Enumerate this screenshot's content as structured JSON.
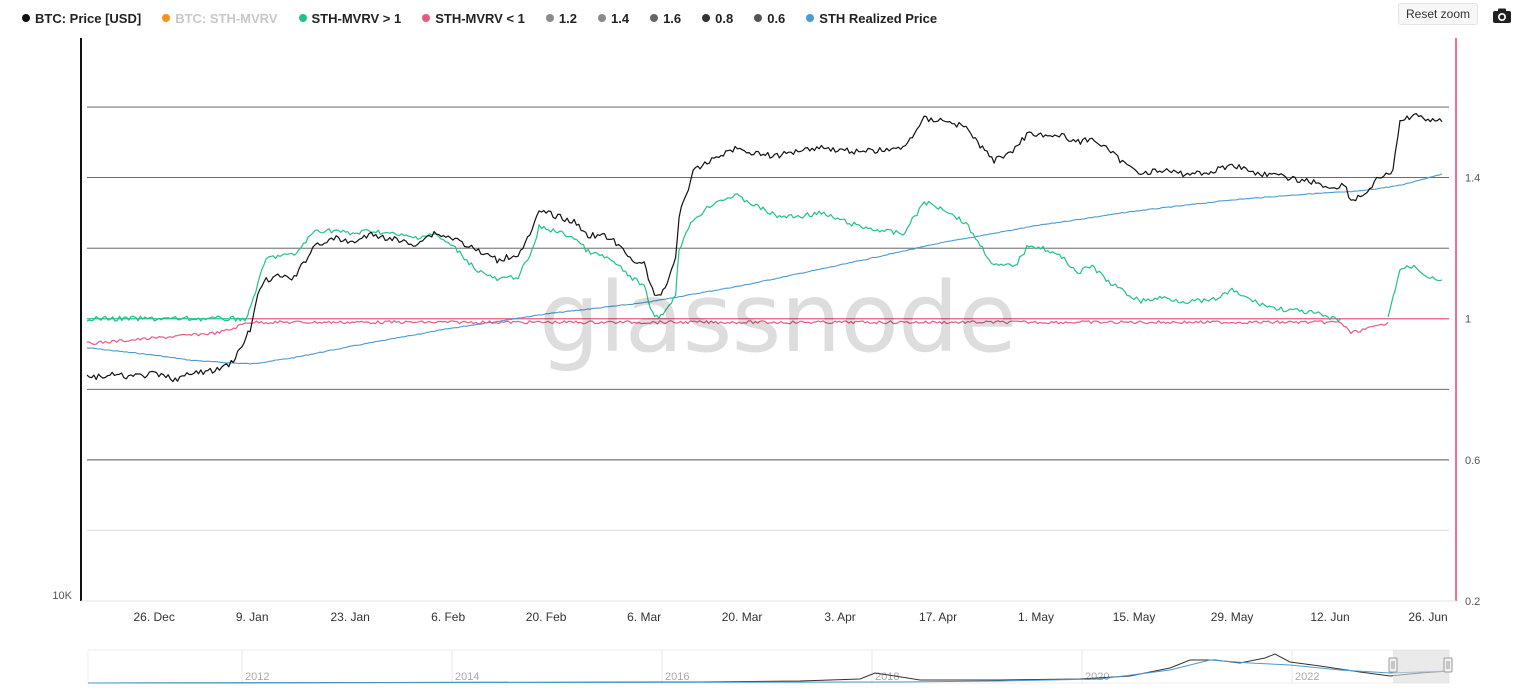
{
  "legend": [
    {
      "label": "BTC: Price [USD]",
      "color": "#111111",
      "active": true
    },
    {
      "label": "BTC: STH-MVRV",
      "color": "#f7931a",
      "active": false
    },
    {
      "label": "STH-MVRV > 1",
      "color": "#1fc28a",
      "active": true
    },
    {
      "label": "STH-MVRV < 1",
      "color": "#e85a7e",
      "active": true
    },
    {
      "label": "1.2",
      "color": "#8a8a8a",
      "active": true
    },
    {
      "label": "1.4",
      "color": "#8a8a8a",
      "active": true
    },
    {
      "label": "1.6",
      "color": "#666666",
      "active": true
    },
    {
      "label": "0.8",
      "color": "#333333",
      "active": true
    },
    {
      "label": "0.6",
      "color": "#555555",
      "active": true
    },
    {
      "label": "STH Realized Price",
      "color": "#4a9bd1",
      "active": true
    }
  ],
  "toolbar": {
    "reset_zoom_label": "Reset zoom",
    "camera_icon": "camera-icon"
  },
  "watermark": "glassnode",
  "colors": {
    "price": "#111111",
    "mvrv_above": "#1fc28a",
    "mvrv_below": "#e85a7e",
    "realized": "#4a9bd1",
    "level_line": "#555555",
    "left_axis": "#111111",
    "right_axis": "#e0457b"
  },
  "chart_data": {
    "type": "line",
    "x_ticks": [
      "26. Dec",
      "9. Jan",
      "23. Jan",
      "6. Feb",
      "20. Feb",
      "6. Mar",
      "20. Mar",
      "3. Apr",
      "17. Apr",
      "1. May",
      "15. May",
      "29. May",
      "12. Jun",
      "26. Jun"
    ],
    "x_tick_days": [
      0,
      14,
      28,
      42,
      56,
      70,
      84,
      98,
      112,
      126,
      140,
      154,
      168,
      182
    ],
    "x_range": [
      -9.6,
      185.0
    ],
    "y_left_ticks": [
      "10K"
    ],
    "y_left_scale": "log",
    "y_right_ticks": [
      "1.4",
      "1",
      "0.6",
      "0.2"
    ],
    "y_right_tick_values": [
      1.4,
      1.0,
      0.6,
      0.2
    ],
    "y_right_range": [
      0.2,
      1.79
    ],
    "levels": [
      1.6,
      1.4,
      1.2,
      1.0,
      0.8,
      0.6,
      0.4
    ],
    "series": [
      {
        "name": "BTC: Price [USD]",
        "axis": "left",
        "points": [
          [
            -9.6,
            16700
          ],
          [
            -6,
            16800
          ],
          [
            -3,
            16750
          ],
          [
            0,
            16850
          ],
          [
            3,
            16650
          ],
          [
            6,
            16900
          ],
          [
            9,
            17000
          ],
          [
            11,
            17300
          ],
          [
            12.5,
            17900
          ],
          [
            14,
            18900
          ],
          [
            14.8,
            20300
          ],
          [
            16,
            20900
          ],
          [
            18,
            21100
          ],
          [
            20,
            21000
          ],
          [
            23,
            22700
          ],
          [
            26,
            23000
          ],
          [
            28,
            22800
          ],
          [
            31,
            23200
          ],
          [
            34,
            23000
          ],
          [
            37,
            22700
          ],
          [
            40,
            23300
          ],
          [
            43,
            23000
          ],
          [
            46,
            22400
          ],
          [
            49,
            21900
          ],
          [
            52,
            22200
          ],
          [
            54,
            23400
          ],
          [
            55,
            24500
          ],
          [
            57,
            24300
          ],
          [
            60,
            23900
          ],
          [
            62,
            23200
          ],
          [
            65,
            23100
          ],
          [
            68,
            22000
          ],
          [
            70,
            21700
          ],
          [
            71.5,
            20100
          ],
          [
            73,
            20500
          ],
          [
            74.5,
            22100
          ],
          [
            75,
            24200
          ],
          [
            77,
            26800
          ],
          [
            80,
            27700
          ],
          [
            83,
            28300
          ],
          [
            86,
            28000
          ],
          [
            89,
            27800
          ],
          [
            92,
            28200
          ],
          [
            95,
            28400
          ],
          [
            98,
            28200
          ],
          [
            101,
            28100
          ],
          [
            104,
            28200
          ],
          [
            107,
            28300
          ],
          [
            110,
            30300
          ],
          [
            113,
            30200
          ],
          [
            116,
            29700
          ],
          [
            118,
            28500
          ],
          [
            120,
            27500
          ],
          [
            123,
            28300
          ],
          [
            125,
            29400
          ],
          [
            127,
            29200
          ],
          [
            130,
            29100
          ],
          [
            132,
            28700
          ],
          [
            134,
            29000
          ],
          [
            136,
            28300
          ],
          [
            139,
            27200
          ],
          [
            141,
            26800
          ],
          [
            144,
            26900
          ],
          [
            147,
            26700
          ],
          [
            151,
            26800
          ],
          [
            154,
            27300
          ],
          [
            157,
            26800
          ],
          [
            160,
            26600
          ],
          [
            164,
            26300
          ],
          [
            166,
            26200
          ],
          [
            168,
            25800
          ],
          [
            170,
            26100
          ],
          [
            171,
            25100
          ],
          [
            173,
            25500
          ],
          [
            175,
            26500
          ],
          [
            177,
            26800
          ],
          [
            178,
            30200
          ],
          [
            180,
            30500
          ],
          [
            182,
            30300
          ],
          [
            184,
            30100
          ]
        ]
      },
      {
        "name": "STH-MVRV > 1",
        "axis": "right",
        "points": [
          [
            -9.6,
            1.0
          ],
          [
            13.3,
            1.0
          ],
          [
            13.5,
            1.02
          ],
          [
            14.5,
            1.08
          ],
          [
            16,
            1.17
          ],
          [
            18,
            1.18
          ],
          [
            20,
            1.18
          ],
          [
            23,
            1.25
          ],
          [
            26,
            1.25
          ],
          [
            28,
            1.24
          ],
          [
            31,
            1.25
          ],
          [
            34,
            1.24
          ],
          [
            37,
            1.23
          ],
          [
            40,
            1.24
          ],
          [
            43,
            1.2
          ],
          [
            46,
            1.14
          ],
          [
            49,
            1.11
          ],
          [
            52,
            1.12
          ],
          [
            54,
            1.19
          ],
          [
            55,
            1.26
          ],
          [
            57,
            1.25
          ],
          [
            60,
            1.23
          ],
          [
            62,
            1.19
          ],
          [
            65,
            1.17
          ],
          [
            68,
            1.12
          ],
          [
            70,
            1.09
          ],
          [
            71.5,
            1.0
          ],
          [
            73,
            1.02
          ],
          [
            74.5,
            1.07
          ],
          [
            75,
            1.2
          ],
          [
            77,
            1.28
          ],
          [
            80,
            1.33
          ],
          [
            83,
            1.35
          ],
          [
            86,
            1.32
          ],
          [
            89,
            1.29
          ],
          [
            92,
            1.29
          ],
          [
            95,
            1.3
          ],
          [
            98,
            1.28
          ],
          [
            101,
            1.26
          ],
          [
            104,
            1.25
          ],
          [
            107,
            1.24
          ],
          [
            110,
            1.33
          ],
          [
            113,
            1.31
          ],
          [
            116,
            1.27
          ],
          [
            118,
            1.21
          ],
          [
            120,
            1.15
          ],
          [
            123,
            1.15
          ],
          [
            125,
            1.21
          ],
          [
            127,
            1.2
          ],
          [
            130,
            1.17
          ],
          [
            132,
            1.13
          ],
          [
            134,
            1.15
          ],
          [
            136,
            1.11
          ],
          [
            139,
            1.07
          ],
          [
            141,
            1.05
          ],
          [
            144,
            1.06
          ],
          [
            147,
            1.05
          ],
          [
            151,
            1.05
          ],
          [
            154,
            1.08
          ],
          [
            157,
            1.05
          ],
          [
            160,
            1.03
          ],
          [
            164,
            1.02
          ],
          [
            166,
            1.015
          ],
          [
            168,
            1.0
          ],
          [
            169.5,
            1.0
          ]
        ]
      },
      {
        "name": "STH-MVRV < 1",
        "axis": "right",
        "points": [
          [
            -9.6,
            0.93
          ],
          [
            -6,
            0.935
          ],
          [
            -3,
            0.94
          ],
          [
            0,
            0.945
          ],
          [
            3,
            0.95
          ],
          [
            6,
            0.955
          ],
          [
            9,
            0.96
          ],
          [
            11,
            0.97
          ],
          [
            13.3,
            0.99
          ],
          [
            169.5,
            0.99
          ],
          [
            170,
            0.98
          ],
          [
            171,
            0.96
          ],
          [
            173,
            0.97
          ],
          [
            175,
            0.98
          ],
          [
            176.3,
            0.99
          ]
        ]
      },
      {
        "name": "STH-MVRV > 1",
        "axis": "right",
        "points": [
          [
            176.3,
            1.0
          ],
          [
            177,
            1.06
          ],
          [
            178,
            1.14
          ],
          [
            180,
            1.15
          ],
          [
            182,
            1.12
          ],
          [
            184,
            1.11
          ]
        ]
      },
      {
        "name": "STH Realized Price",
        "axis": "left",
        "points": [
          [
            -9.6,
            17900
          ],
          [
            0,
            17600
          ],
          [
            5,
            17400
          ],
          [
            10,
            17300
          ],
          [
            14,
            17250
          ],
          [
            20,
            17500
          ],
          [
            28,
            17950
          ],
          [
            42,
            18700
          ],
          [
            56,
            19350
          ],
          [
            70,
            19850
          ],
          [
            84,
            20650
          ],
          [
            98,
            21650
          ],
          [
            112,
            22750
          ],
          [
            126,
            23700
          ],
          [
            140,
            24500
          ],
          [
            154,
            25150
          ],
          [
            165,
            25500
          ],
          [
            172,
            25650
          ],
          [
            178,
            26000
          ],
          [
            184,
            26700
          ]
        ]
      }
    ],
    "navigator": {
      "year_labels": [
        "2012",
        "2014",
        "2016",
        "2018",
        "2020",
        "2022"
      ]
    },
    "grid": false,
    "legend_position": "top-left"
  }
}
